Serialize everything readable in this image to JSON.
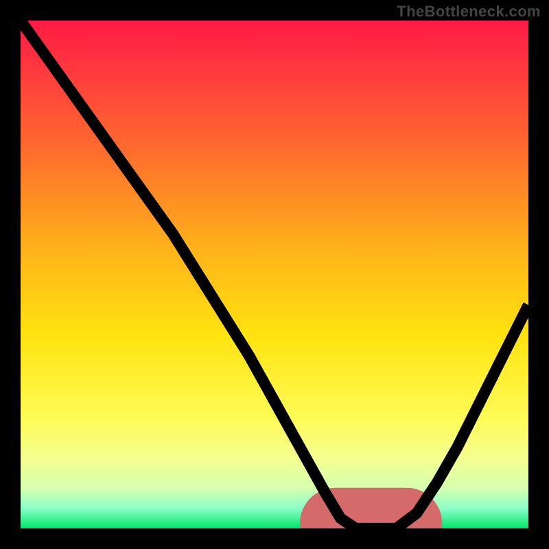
{
  "watermark": "TheBottleneck.com",
  "colors": {
    "background": "#000000",
    "gradient_top": "#ff1a44",
    "gradient_mid": "#ffe30f",
    "gradient_bottom": "#00e66b",
    "curve": "#000000",
    "valley_marker": "#d46a6a"
  },
  "chart_data": {
    "type": "line",
    "title": "",
    "xlabel": "",
    "ylabel": "",
    "xlim": [
      0,
      100
    ],
    "ylim": [
      0,
      100
    ],
    "note": "No axis ticks or numeric labels are rendered in the image; values below are geometric estimates from the curve shape on a 0–100 normalized grid.",
    "series": [
      {
        "name": "curve",
        "x": [
          0,
          5,
          10,
          15,
          20,
          25,
          30,
          35,
          40,
          45,
          50,
          55,
          60,
          63,
          66,
          70,
          74,
          78,
          82,
          86,
          90,
          94,
          98,
          100
        ],
        "y": [
          100,
          93,
          86,
          79,
          72,
          65,
          58,
          50,
          42,
          34,
          25,
          16,
          7,
          2,
          0,
          0,
          0,
          3,
          9,
          16,
          24,
          32,
          40,
          44
        ]
      }
    ],
    "valley_marker": {
      "x_start": 62,
      "x_end": 76,
      "y": 0
    },
    "background_gradient": {
      "direction": "vertical",
      "stops": [
        {
          "pos": 0.0,
          "color": "#ff1a44"
        },
        {
          "pos": 0.25,
          "color": "#ff6a2e"
        },
        {
          "pos": 0.62,
          "color": "#ffe30f"
        },
        {
          "pos": 0.92,
          "color": "#d6ffb0"
        },
        {
          "pos": 1.0,
          "color": "#00e66b"
        }
      ]
    }
  }
}
